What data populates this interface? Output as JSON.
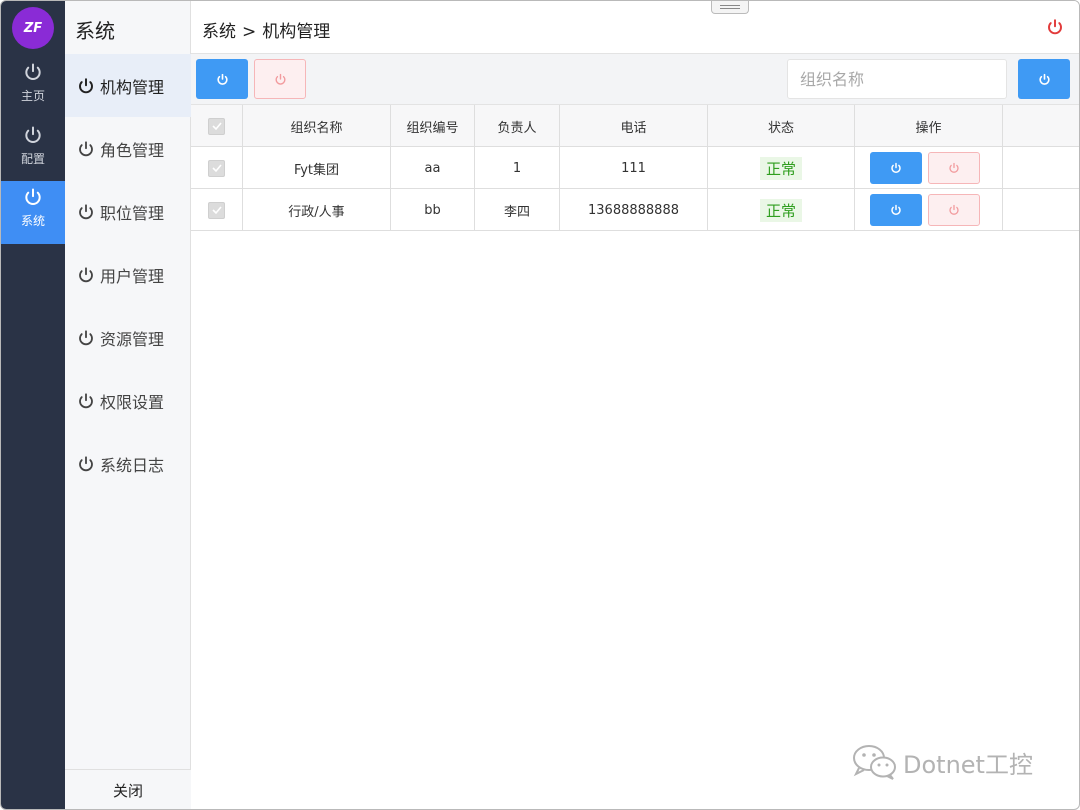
{
  "rail": {
    "logo_text": "ZF",
    "items": [
      {
        "label": "主页"
      },
      {
        "label": "配置"
      },
      {
        "label": "系统"
      }
    ]
  },
  "subnav": {
    "title": "系统",
    "items": [
      {
        "label": "机构管理"
      },
      {
        "label": "角色管理"
      },
      {
        "label": "职位管理"
      },
      {
        "label": "用户管理"
      },
      {
        "label": "资源管理"
      },
      {
        "label": "权限设置"
      },
      {
        "label": "系统日志"
      }
    ],
    "close_label": "关闭"
  },
  "header": {
    "crumb_root": "系统",
    "crumb_sep": ">",
    "crumb_current": "机构管理"
  },
  "toolbar": {
    "search_placeholder": "组织名称"
  },
  "table": {
    "columns": [
      "组织名称",
      "组织编号",
      "负责人",
      "电话",
      "状态",
      "操作"
    ],
    "rows": [
      {
        "name": "Fyt集团",
        "code": "aa",
        "leader": "1",
        "phone": "111",
        "status": "正常"
      },
      {
        "name": "行政/人事",
        "code": "bb",
        "leader": "李四",
        "phone": "13688888888",
        "status": "正常"
      }
    ]
  },
  "watermark": {
    "text": "Dotnet工控"
  },
  "colors": {
    "rail_bg": "#2a3346",
    "accent": "#3f9af4",
    "danger": "#e23b3b",
    "status_green": "#2f9e1e",
    "logo": "#8a2bd6"
  }
}
